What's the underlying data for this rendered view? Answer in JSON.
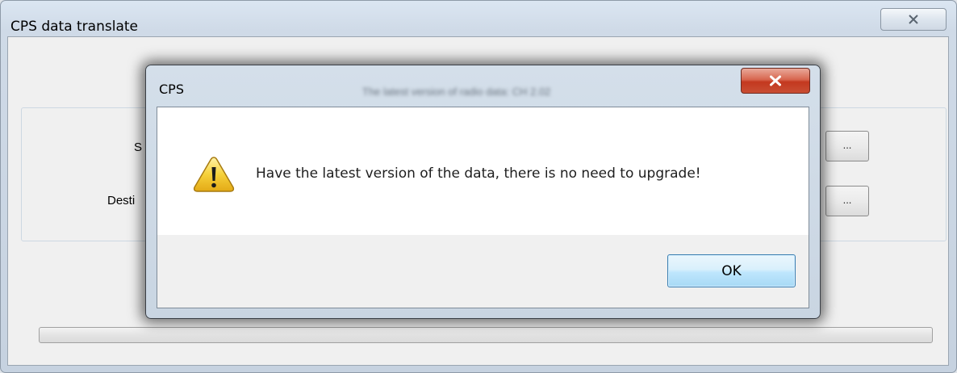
{
  "main_window": {
    "title": "CPS data translate",
    "close_glyph": "✕",
    "fields": [
      {
        "label": "S",
        "browse_label": "..."
      },
      {
        "label": "Desti",
        "browse_label": "..."
      }
    ],
    "progress": 0
  },
  "dialog": {
    "title": "CPS",
    "background_text": "The latest version of radio data: CH 2.02",
    "close_glyph": "✕",
    "icon": "warning-icon",
    "message": "Have the latest version of the data, there is no need to upgrade!",
    "ok_label": "OK"
  },
  "colors": {
    "warning_yellow": "#f6c82c",
    "close_red": "#c94e33",
    "ok_border": "#3c7fb1"
  }
}
